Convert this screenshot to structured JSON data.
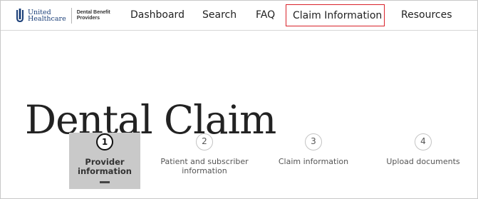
{
  "header": {
    "logo": {
      "brand_line1": "United",
      "brand_line2": "Healthcare",
      "product_line1": "Dental Benefit",
      "product_line2": "Providers"
    },
    "nav": [
      {
        "label": "Dashboard"
      },
      {
        "label": "Search"
      },
      {
        "label": "FAQ"
      },
      {
        "label": "Claim Information",
        "active": true
      },
      {
        "label": "Resources"
      }
    ],
    "active_border_color": "#d9222a"
  },
  "page": {
    "title": "Dental Claim"
  },
  "stepper": {
    "current_step": 1,
    "steps": [
      {
        "number": "1",
        "label": "Provider information"
      },
      {
        "number": "2",
        "label": "Patient and subscriber information"
      },
      {
        "number": "3",
        "label": "Claim information"
      },
      {
        "number": "4",
        "label": "Upload documents"
      }
    ]
  }
}
